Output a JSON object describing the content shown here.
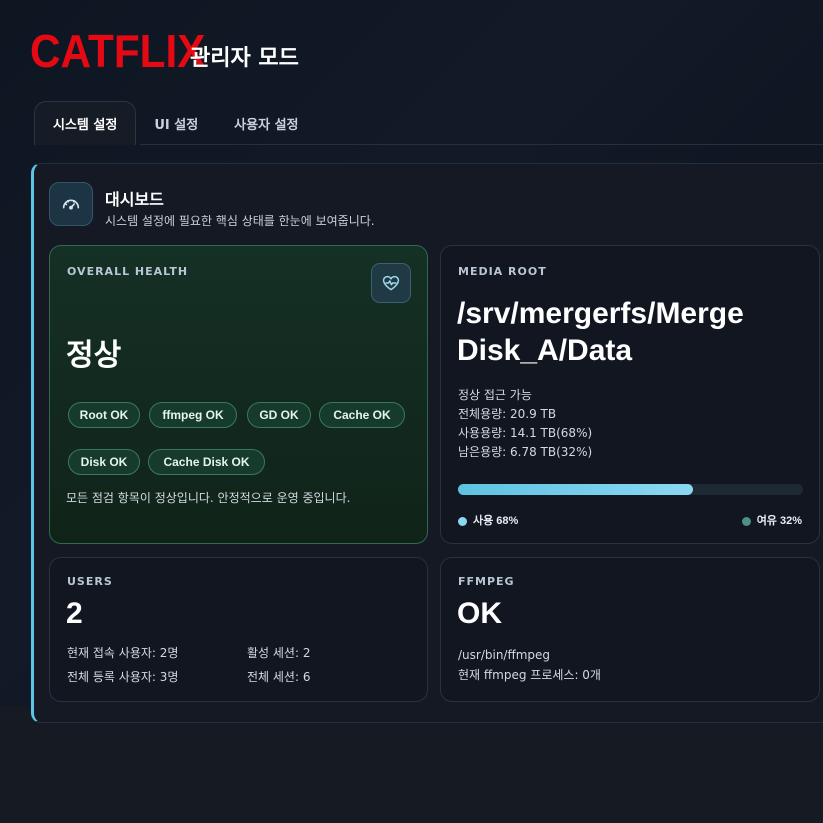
{
  "brand": {
    "logo": "CATFLIX",
    "mode": "관리자 모드"
  },
  "tabs": [
    {
      "label": "시스템 설정",
      "active": true
    },
    {
      "label": "UI 설정",
      "active": false
    },
    {
      "label": "사용자 설정",
      "active": false
    }
  ],
  "dashboard": {
    "title": "대시보드",
    "subtitle": "시스템 설정에 필요한 핵심 상태를 한눈에 보여줍니다.",
    "icon": "speedometer-icon"
  },
  "health": {
    "label": "OVERALL HEALTH",
    "status": "정상",
    "icon": "heart-pulse-icon",
    "checks": [
      "Root OK",
      "ffmpeg OK",
      "GD OK",
      "Cache OK",
      "Disk OK",
      "Cache Disk OK"
    ],
    "message": "모든 점검 항목이 정상입니다. 안정적으로 운영 중입니다."
  },
  "media": {
    "label": "MEDIA ROOT",
    "path_line1": "/srv/mergerfs/Merge",
    "path_line2": "Disk_A/Data",
    "access": "정상 접근 가능",
    "total": "전체용량: 20.9 TB",
    "used": "사용용량: 14.1 TB(68%)",
    "free": "남은용량: 6.78 TB(32%)",
    "used_percent": 68,
    "legend_used": "사용 68%",
    "legend_free": "여유 32%"
  },
  "users": {
    "label": "USERS",
    "count": "2",
    "online": "현재 접속 사용자: 2명",
    "registered": "전체 등록 사용자: 3명",
    "active_sessions": "활성 세션: 2",
    "total_sessions": "전체 세션: 6"
  },
  "ffmpeg": {
    "label": "FFMPEG",
    "status": "OK",
    "path": "/usr/bin/ffmpeg",
    "processes": "현재 ffmpeg 프로세스: 0개"
  },
  "colors": {
    "brand_red": "#e50914",
    "accent": "#5ec4e6",
    "health_green": "#2f6a4d"
  }
}
